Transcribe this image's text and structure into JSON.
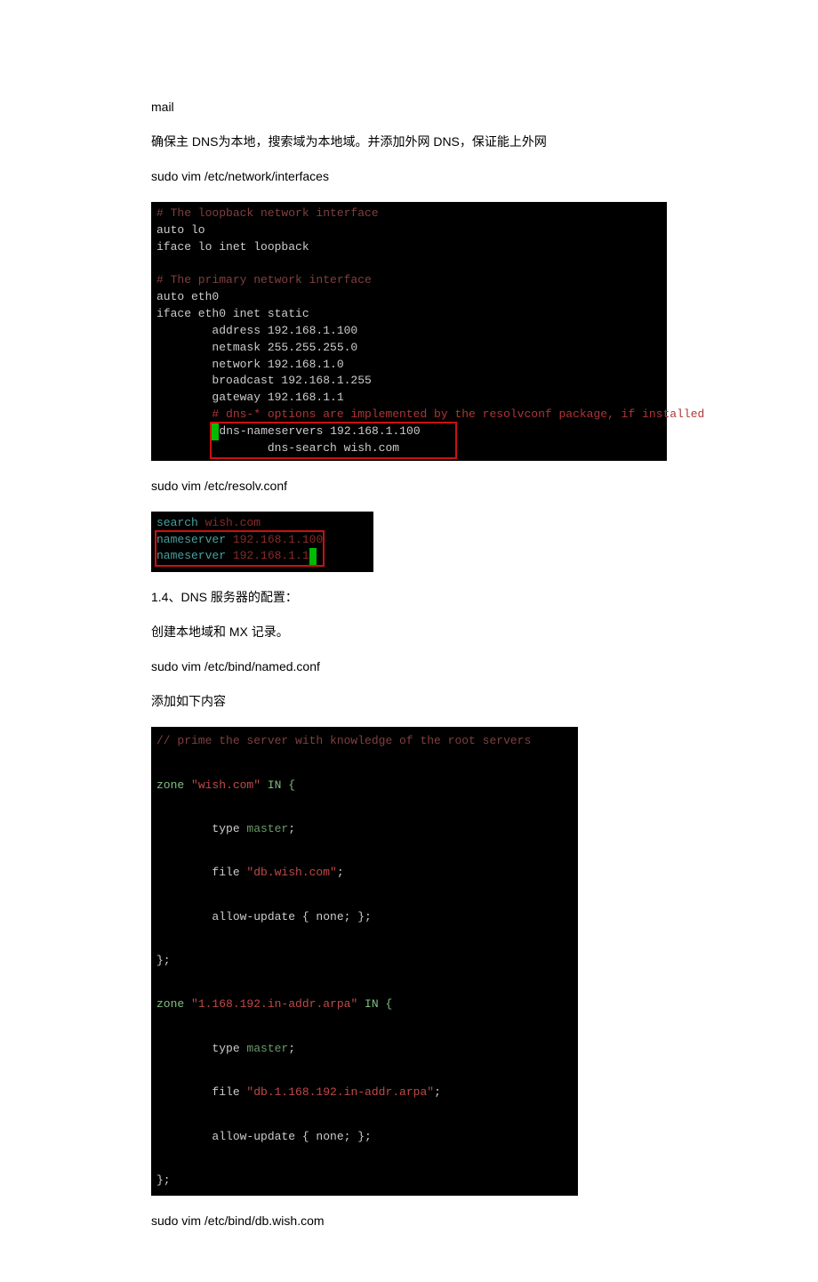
{
  "para1": "mail",
  "para2": "确保主 DNS为本地，搜索域为本地域。并添加外网 DNS，保证能上外网",
  "para3": "sudo vim /etc/network/interfaces",
  "term1": {
    "l1": "# The loopback network interface",
    "l2": "auto lo",
    "l3": "iface lo inet loopback",
    "l4": "",
    "l5": "# The primary network interface",
    "l6": "auto eth0",
    "l7": "iface eth0 inet static",
    "l8": "        address 192.168.1.100",
    "l9": "        netmask 255.255.255.0",
    "l10": "        network 192.168.1.0",
    "l11": "        broadcast 192.168.1.255",
    "l12": "        gateway 192.168.1.1",
    "l13": "        # dns-* options are implemented by the resolvconf package, if installed",
    "l14a": "        ",
    "l14b": "dns-nameservers 192.168.1.100",
    "l15a": "        ",
    "l15b": "dns-search wish.com"
  },
  "para4": "sudo vim /etc/resolv.conf",
  "term2": {
    "l1a": "search ",
    "l1b": "wish.com",
    "l2a": "nameserver ",
    "l2b": "192.168.1.100",
    "l3a": "nameserver ",
    "l3b": "192.168.1.1"
  },
  "para5": "1.4、DNS 服务器的配置：",
  "para6": "创建本地域和 MX 记录。",
  "para7": "sudo vim /etc/bind/named.conf",
  "para8": "添加如下内容",
  "term3": {
    "l1": "// prime the server with knowledge of the root servers",
    "l2a": "zone ",
    "l2b": "\"wish.com\"",
    "l2c": " IN {",
    "l3a": "        type ",
    "l3b": "master",
    "l3c": ";",
    "l4a": "        file ",
    "l4b": "\"db.wish.com\"",
    "l4c": ";",
    "l5": "        allow-update { none; };",
    "l6": "};",
    "l7a": "zone ",
    "l7b": "\"1.168.192.in-addr.arpa\"",
    "l7c": " IN {",
    "l8a": "        type ",
    "l8b": "master",
    "l8c": ";",
    "l9a": "        file ",
    "l9b": "\"db.1.168.192.in-addr.arpa\"",
    "l9c": ";",
    "l10": "        allow-update { none; };",
    "l11": "};"
  },
  "para9": "sudo vim /etc/bind/db.wish.com"
}
